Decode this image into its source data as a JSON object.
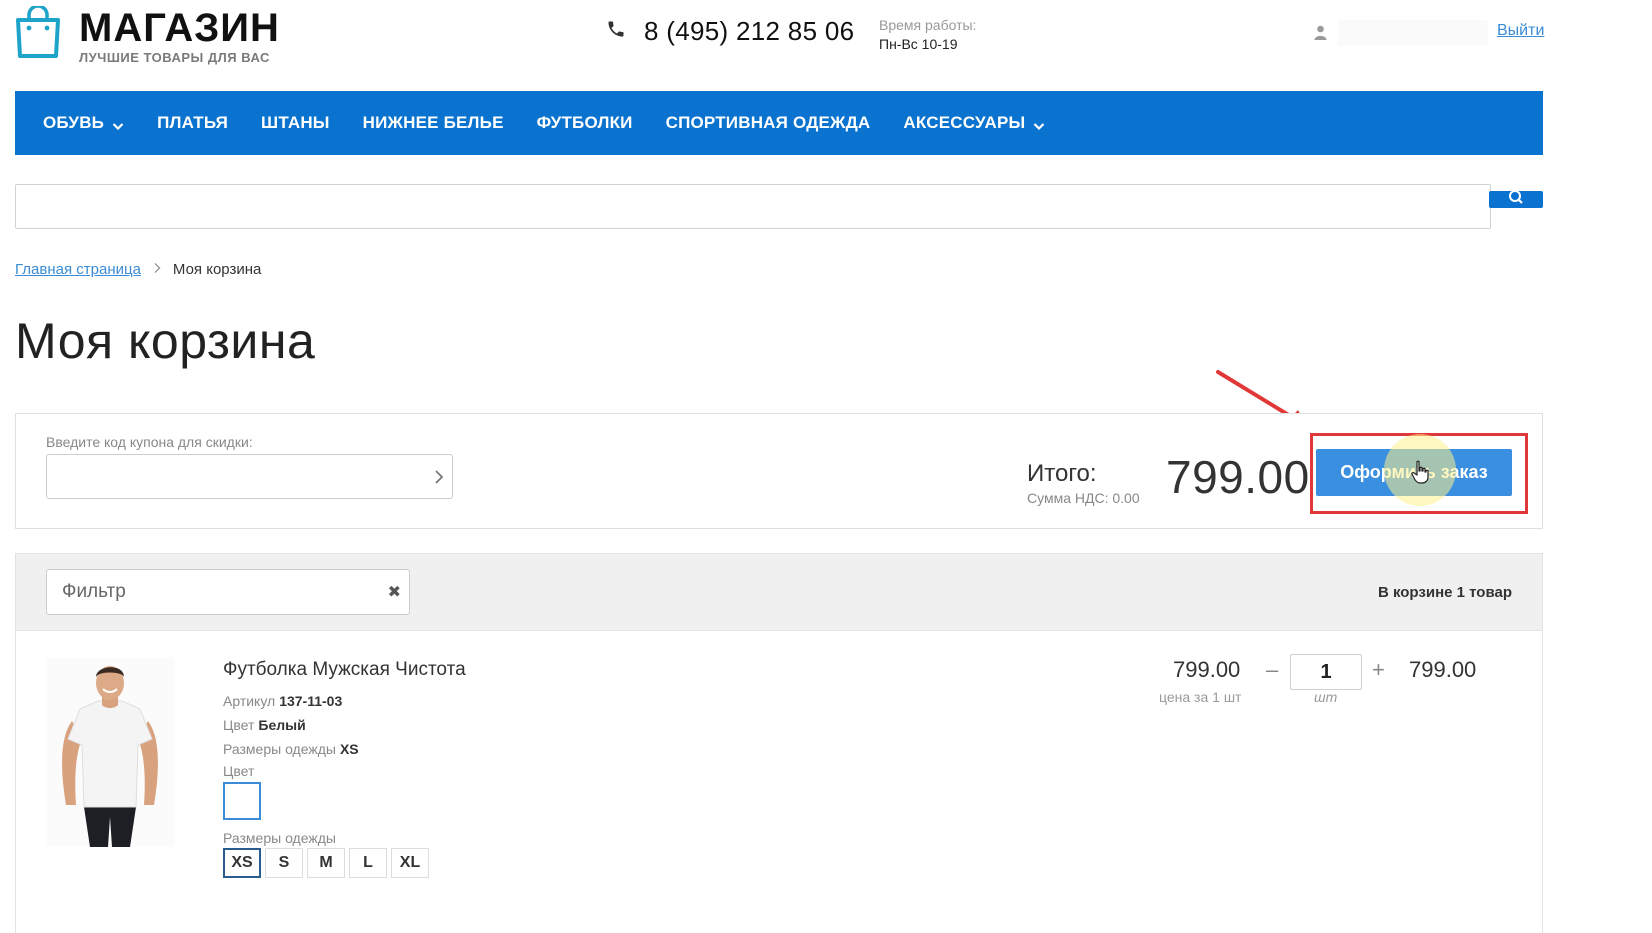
{
  "header": {
    "logo_title": "МАГАЗИН",
    "logo_subtitle": "ЛУЧШИЕ ТОВАРЫ ДЛЯ ВАС",
    "phone": "8 (495) 212 85 06",
    "hours_label": "Время работы:",
    "hours_value": "Пн-Вс 10-19",
    "logout": "Выйти"
  },
  "nav": {
    "items": [
      {
        "label": "ОБУВЬ",
        "has_dropdown": true
      },
      {
        "label": "ПЛАТЬЯ",
        "has_dropdown": false
      },
      {
        "label": "ШТАНЫ",
        "has_dropdown": false
      },
      {
        "label": "НИЖНЕЕ БЕЛЬЕ",
        "has_dropdown": false
      },
      {
        "label": "ФУТБОЛКИ",
        "has_dropdown": false
      },
      {
        "label": "СПОРТИВНАЯ ОДЕЖДА",
        "has_dropdown": false
      },
      {
        "label": "АКСЕССУАРЫ",
        "has_dropdown": true
      }
    ]
  },
  "search": {
    "placeholder": ""
  },
  "breadcrumb": {
    "home": "Главная страница",
    "current": "Моя корзина"
  },
  "page_title": "Моя корзина",
  "coupon": {
    "label": "Введите код купона для скидки:",
    "value": ""
  },
  "summary": {
    "total_label": "Итого:",
    "vat": "Сумма НДС: 0.00",
    "total_value": "799.00",
    "checkout_label": "Оформить заказ"
  },
  "cart": {
    "filter_placeholder": "Фильтр",
    "count_text": "В корзине 1 товар",
    "items": [
      {
        "name": "Футболка Мужская Чистота",
        "article_label": "Артикул",
        "article": "137-11-03",
        "color_label": "Цвет",
        "color": "Белый",
        "size_label": "Размеры одежды",
        "size": "XS",
        "color_picker_label": "Цвет",
        "size_picker_label": "Размеры одежды",
        "sizes": [
          "XS",
          "S",
          "M",
          "L",
          "XL"
        ],
        "selected_size": "XS",
        "unit_price": "799.00",
        "unit_note": "цена за 1 шт",
        "quantity": "1",
        "quantity_unit": "шт",
        "total": "799.00"
      }
    ]
  },
  "colors": {
    "brand_blue": "#0a73cf",
    "link_blue": "#3a8cd6",
    "button_blue": "#3b8fe0",
    "annotation_red": "#e03838"
  }
}
